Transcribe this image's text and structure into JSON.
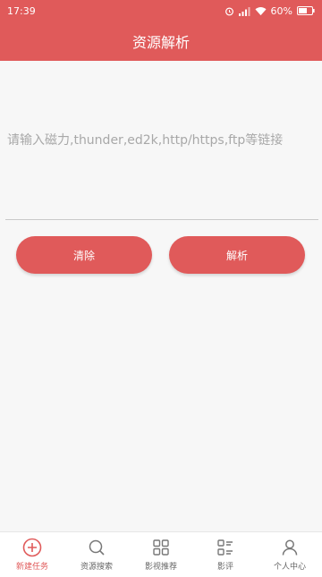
{
  "status_bar": {
    "time": "17:39",
    "battery": "60%"
  },
  "header": {
    "title": "资源解析"
  },
  "main": {
    "input_placeholder": "请输入磁力,thunder,ed2k,http/https,ftp等链接",
    "input_value": "",
    "clear_label": "清除",
    "parse_label": "解析"
  },
  "tabs": [
    {
      "label": "新建任务",
      "icon": "plus-circle-icon",
      "active": true
    },
    {
      "label": "资源搜索",
      "icon": "search-icon",
      "active": false
    },
    {
      "label": "影视推荐",
      "icon": "grid-icon",
      "active": false
    },
    {
      "label": "影评",
      "icon": "list-icon",
      "active": false
    },
    {
      "label": "个人中心",
      "icon": "user-icon",
      "active": false
    }
  ],
  "colors": {
    "accent": "#e05a5a",
    "background": "#f7f7f7",
    "tab_inactive": "#666666"
  }
}
